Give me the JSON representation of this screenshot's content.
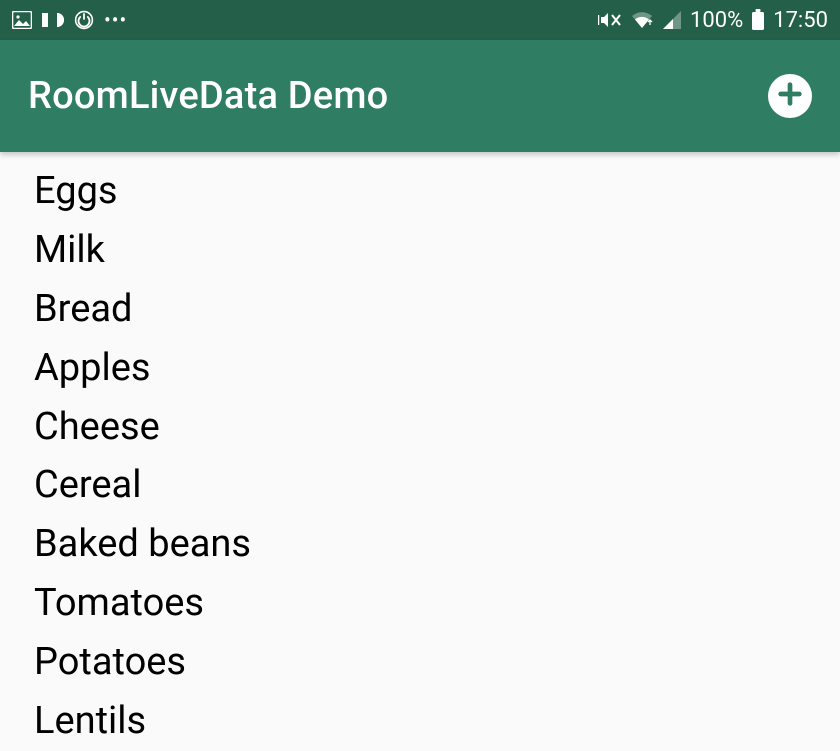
{
  "status_bar": {
    "battery_percent": "100%",
    "time": "17:50"
  },
  "app_bar": {
    "title": "RoomLiveData Demo"
  },
  "list": {
    "items": [
      "Eggs",
      "Milk",
      "Bread",
      "Apples",
      "Cheese",
      "Cereal",
      "Baked beans",
      "Tomatoes",
      "Potatoes",
      "Lentils"
    ]
  },
  "colors": {
    "status_bar_bg": "#245f4a",
    "app_bar_bg": "#2f7d62"
  }
}
